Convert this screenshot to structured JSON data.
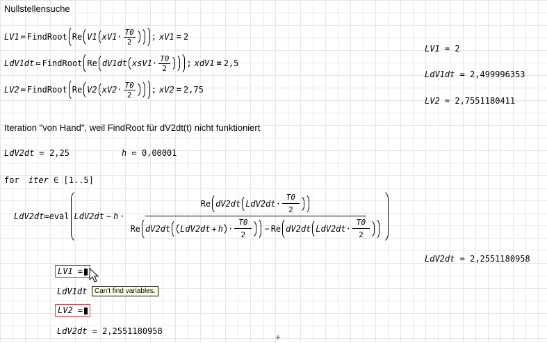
{
  "section_title": "Nullstellensuche",
  "eq1": {
    "lhs": "LV1",
    "def": "≔",
    "fn": "FindRoot",
    "re": "Re",
    "f": "V1",
    "x": "xV1",
    "dot": "·",
    "t0": "T0",
    "two": "2",
    "semi": ";",
    "guessvar": "xV1",
    "bold_eq": "=",
    "guess": "2"
  },
  "eq2": {
    "lhs": "LdV1dt",
    "def": "≔",
    "fn": "FindRoot",
    "re": "Re",
    "f": "dV1dt",
    "x": "xsV1",
    "dot": "·",
    "t0": "T0",
    "two": "2",
    "semi": ";",
    "guessvar": "xdV1",
    "bold_eq": "=",
    "guess": "2,5"
  },
  "eq3": {
    "lhs": "LV2",
    "def": "≔",
    "fn": "FindRoot",
    "re": "Re",
    "f": "V2",
    "x": "xV2",
    "dot": "·",
    "t0": "T0",
    "two": "2",
    "semi": ";",
    "guessvar": "xV2",
    "bold_eq": "=",
    "guess": "2,75"
  },
  "results": {
    "r1_lhs": "LV1",
    "r1_val": "2",
    "r2_lhs": "LdV1dt",
    "r2_val": "2,499996353",
    "r3_lhs": "LV2",
    "r3_val": "2,7551180411",
    "eq": "="
  },
  "iteration_text": "Iteration \"von Hand\", weil FindRoot für dV2dt(t) nicht funktioniert",
  "init": {
    "lhs": "LdV2dt",
    "def": "≔",
    "val": "2,25",
    "h_lhs": "h",
    "h_val": "0,00001"
  },
  "loop": {
    "for": "for",
    "iter": "iter",
    "in": "∈",
    "range": "[1..5]"
  },
  "update": {
    "lhs": "LdV2dt",
    "def": "≔",
    "eval": "eval",
    "var": "LdV2dt",
    "minus": "−",
    "h": "h",
    "dot": "·",
    "re": "Re",
    "f": "dV2dt",
    "t0": "T0",
    "two": "2",
    "plus": "+"
  },
  "final": {
    "lhs": "LdV2dt",
    "eq": "=",
    "val": "2,2551180958"
  },
  "checks": {
    "c1_lhs": "LV1",
    "c2_lhs": "LdV1dt",
    "c3_lhs": "LV2",
    "c4_lhs": "LdV2dt",
    "c4_val": "2,2551180958",
    "eq": "="
  },
  "tooltip": "Can't  find  variables.",
  "marker": "+",
  "colors": {
    "error_box": "#e03030",
    "tooltip_bg": "#ffffe1",
    "marker": "#e03030"
  }
}
